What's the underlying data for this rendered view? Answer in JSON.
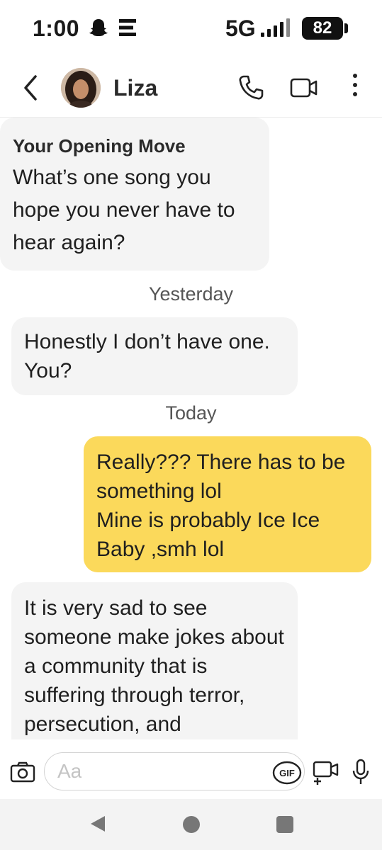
{
  "status_bar": {
    "time": "1:00",
    "network": "5G",
    "battery": "82",
    "icons": [
      "snapchat-icon",
      "e-app-icon",
      "signal-icon",
      "battery-icon"
    ]
  },
  "header": {
    "contact_name": "Liza",
    "icons": [
      "back-arrow-icon",
      "avatar",
      "phone-icon",
      "video-camera-icon",
      "more-vertical-icon"
    ]
  },
  "messages": {
    "opening_move": {
      "title": "Your Opening Move",
      "question": "What’s one song you hope you never have to hear again?"
    },
    "sep_yesterday": "Yesterday",
    "msg1": "Honestly I don’t have one. You?",
    "sep_today": "Today",
    "msg2_line1": "Really??? There has to be something lol",
    "msg2_line2": "Mine is probably Ice Ice Baby ,smh lol",
    "msg3": "It is very sad to see someone make jokes about a community that is suffering through terror, persecution, and"
  },
  "composer": {
    "placeholder": "Aa",
    "gif_label": "GIF"
  },
  "colors": {
    "outgoing_bubble": "#fbd95b",
    "incoming_bubble": "#f4f4f4",
    "nav_bar": "#f3f3f3"
  }
}
